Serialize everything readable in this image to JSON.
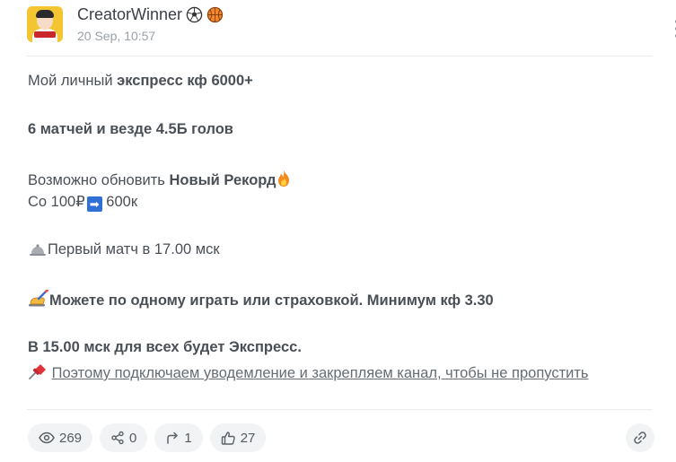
{
  "post": {
    "author": "CreatorWinner",
    "date": "20 Sep, 10:57",
    "author_emojis": [
      "soccer-ball",
      "basketball"
    ]
  },
  "content": {
    "line1_pre": "Мой личный ",
    "line1_bold": "экспресс кф 6000+",
    "line2_bold": "6 матчей и везде 4.5Б голов",
    "line3_pre": "Возможно обновить ",
    "line3_bold": "Новый Рекорд",
    "line4_pre": "Со 100₽",
    "line4_post": " 600к",
    "line5": "Первый матч в 17.00 мск",
    "line6_bold": "Можете по одному играть или страховкой. Минимум кф 3.30",
    "line7_bold": "В 15.00 мск для всех будет Экспресс.",
    "line8_link": "Поэтому подключаем уводемление и закрепляем канал, чтобы не пропустить",
    "arrow_glyph": "➡"
  },
  "stats": {
    "views": "269",
    "shares": "0",
    "forwards": "1",
    "likes": "27"
  },
  "colors": {
    "text": "#4a4f56",
    "muted": "#9aa0a8",
    "pill_bg": "#f1f3f5",
    "arrow_blue": "#2f6fd6"
  }
}
